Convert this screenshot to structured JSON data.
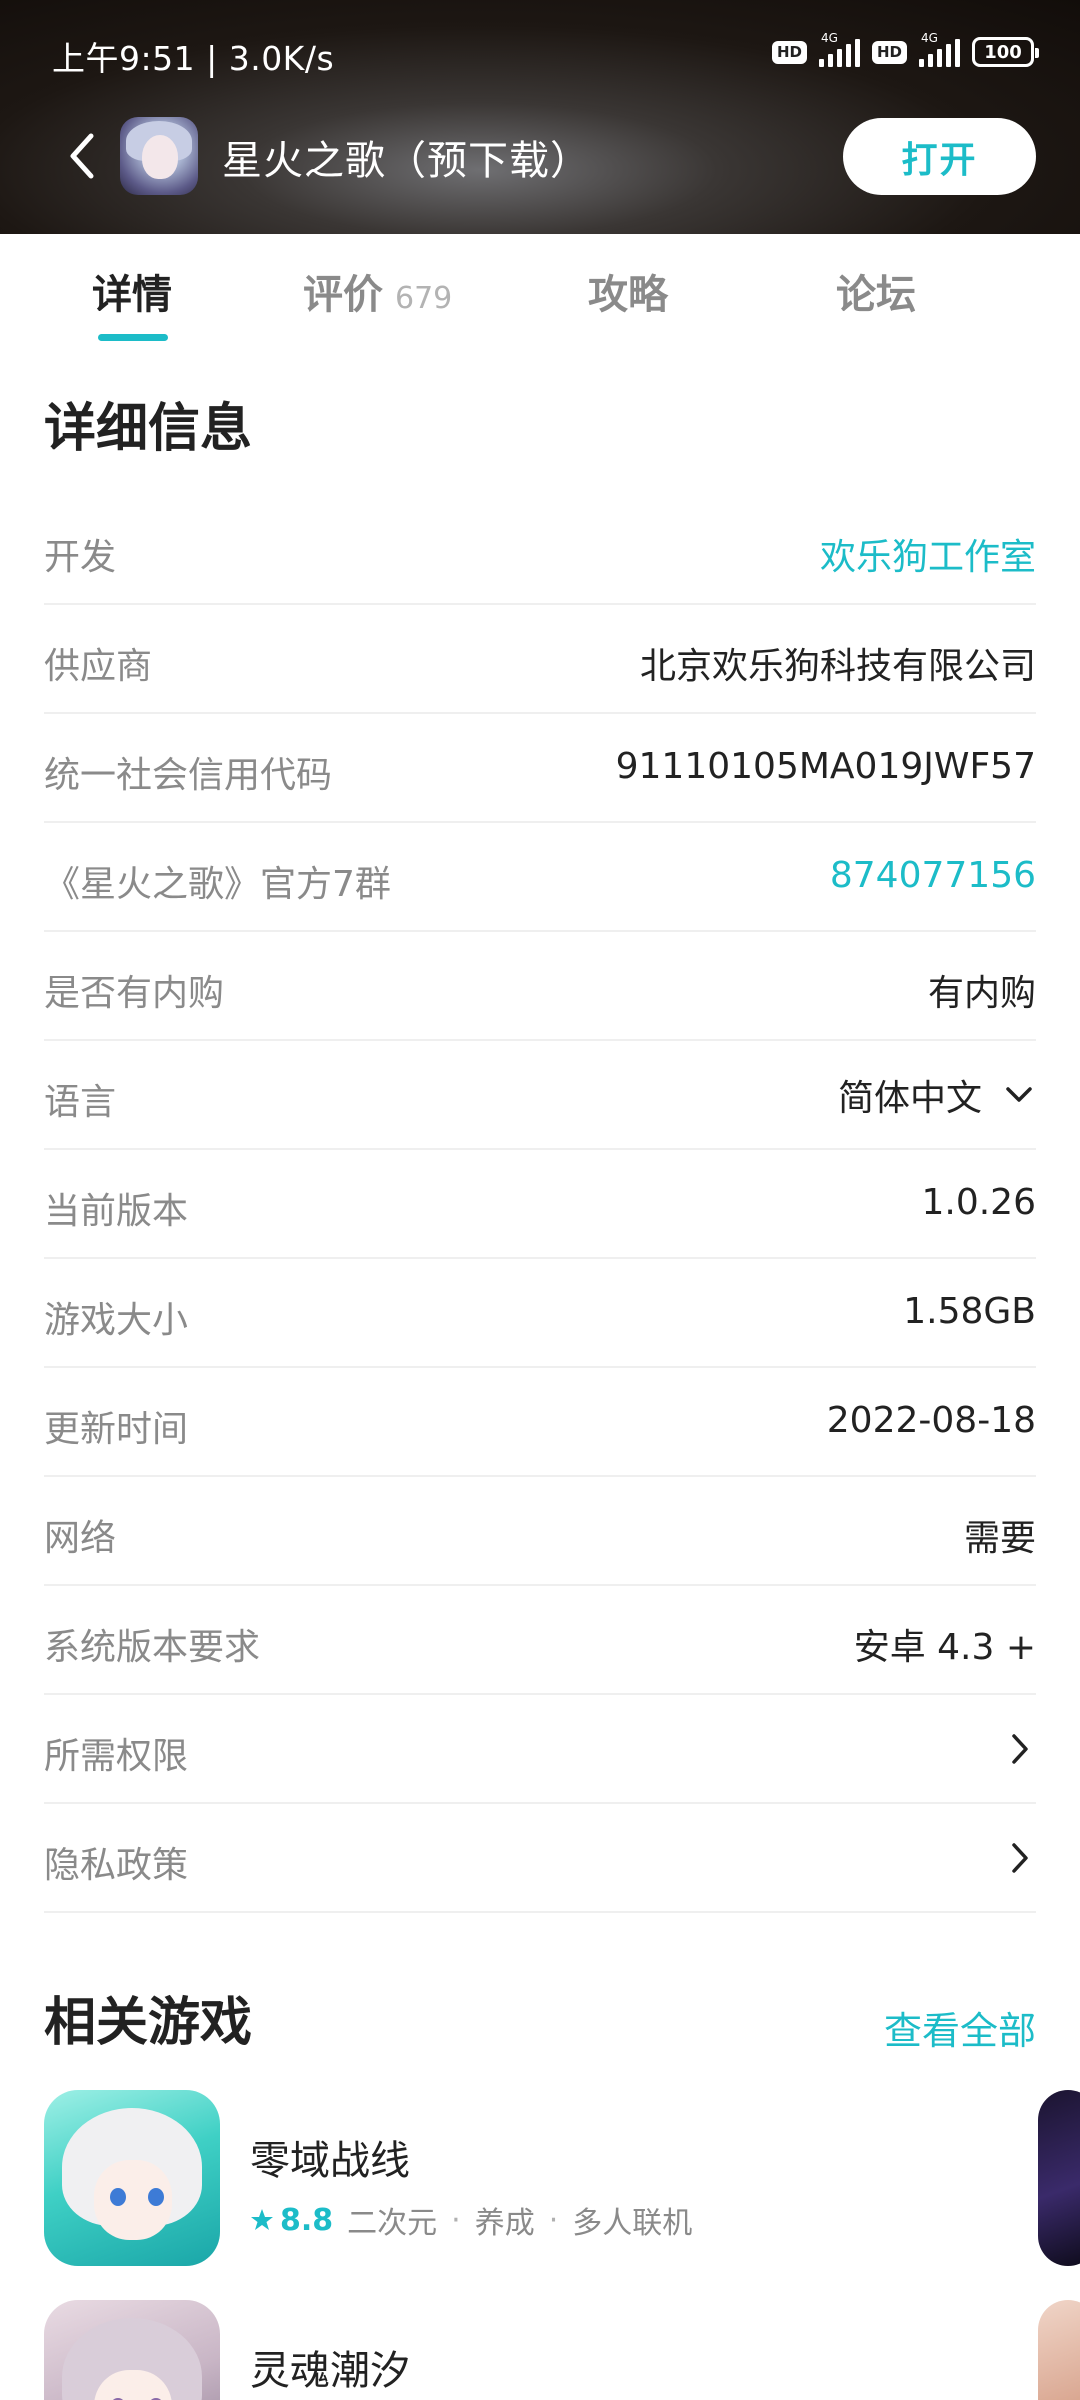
{
  "status_bar": {
    "time": "上午9:51 | 3.0K/s",
    "hd1": "HD",
    "net1": "4G",
    "hd2": "HD",
    "net2": "4G",
    "battery": "100"
  },
  "header": {
    "app_title": "星火之歌（预下载）",
    "open_label": "打开"
  },
  "tabs": [
    {
      "label": "详情",
      "active": true
    },
    {
      "label": "评价",
      "count": "679"
    },
    {
      "label": "攻略"
    },
    {
      "label": "论坛"
    }
  ],
  "details": {
    "title": "详细信息",
    "rows": [
      {
        "label": "开发",
        "value": "欢乐狗工作室"
      },
      {
        "label": "供应商",
        "value": "北京欢乐狗科技有限公司"
      },
      {
        "label": "统一社会信用代码",
        "value": "91110105MA019JWF57"
      },
      {
        "label": "《星火之歌》官方7群",
        "value": "874077156"
      },
      {
        "label": "是否有内购",
        "value": "有内购"
      },
      {
        "label": "语言",
        "value": "简体中文"
      },
      {
        "label": "当前版本",
        "value": "1.0.26"
      },
      {
        "label": "游戏大小",
        "value": "1.58GB"
      },
      {
        "label": "更新时间",
        "value": "2022-08-18"
      },
      {
        "label": "网络",
        "value": "需要"
      },
      {
        "label": "系统版本要求",
        "value": "安卓 4.3 +"
      },
      {
        "label": "所需权限"
      },
      {
        "label": "隐私政策"
      }
    ]
  },
  "related": {
    "title": "相关游戏",
    "view_all": "查看全部",
    "games": [
      {
        "name": "零域战线",
        "rating": "8.8",
        "tags": [
          "二次元",
          "养成",
          "多人联机"
        ]
      },
      {
        "name": "灵魂潮汐"
      }
    ]
  },
  "colors": {
    "accent": "#1cbcc8",
    "label_gray": "#8a8a8a",
    "text_dark": "#222222"
  }
}
